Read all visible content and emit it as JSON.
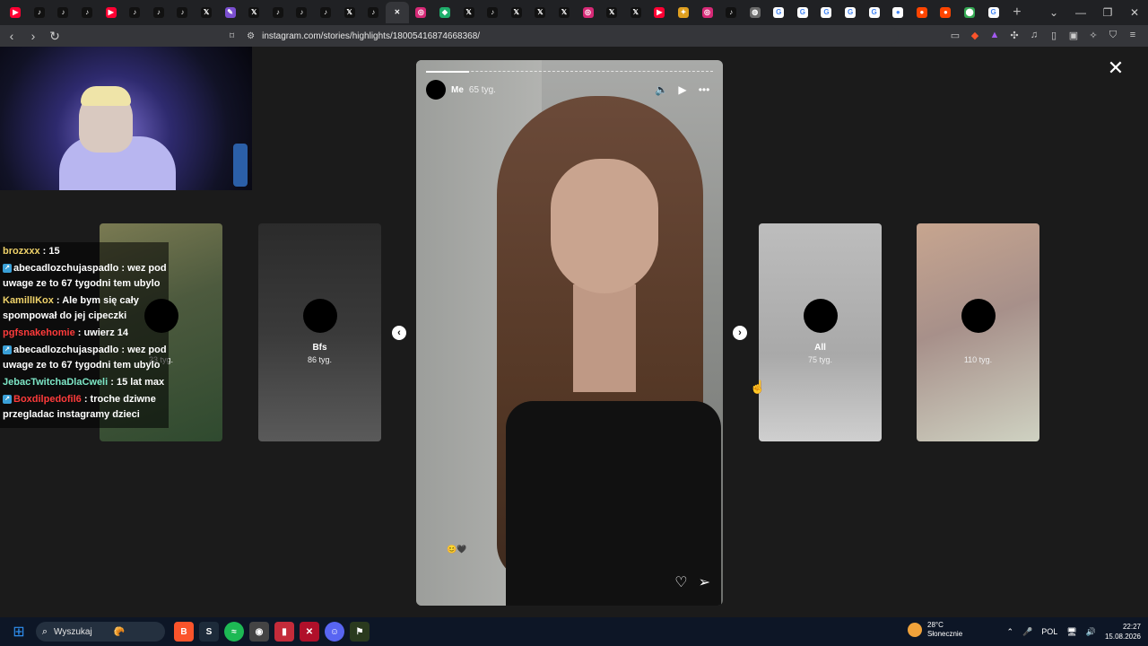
{
  "browser": {
    "tabs": [
      {
        "icon": "youtube-icon",
        "glyph": "▶",
        "color": "#ff0033"
      },
      {
        "icon": "tiktok-icon",
        "glyph": "♪",
        "color": "#111111"
      },
      {
        "icon": "tiktok-icon",
        "glyph": "♪",
        "color": "#111111"
      },
      {
        "icon": "tiktok-icon",
        "glyph": "♪",
        "color": "#111111"
      },
      {
        "icon": "youtube-icon",
        "glyph": "▶",
        "color": "#ff0033"
      },
      {
        "icon": "tiktok-icon",
        "glyph": "♪",
        "color": "#111111"
      },
      {
        "icon": "tiktok-icon",
        "glyph": "♪",
        "color": "#111111"
      },
      {
        "icon": "tiktok-icon",
        "glyph": "♪",
        "color": "#111111"
      },
      {
        "icon": "x-icon",
        "glyph": "𝕏",
        "color": "#111111"
      },
      {
        "icon": "feather-icon",
        "glyph": "✎",
        "color": "#7b4fd0"
      },
      {
        "icon": "x-icon",
        "glyph": "𝕏",
        "color": "#111111"
      },
      {
        "icon": "tiktok-icon",
        "glyph": "♪",
        "color": "#111111"
      },
      {
        "icon": "tiktok-icon",
        "glyph": "♪",
        "color": "#111111"
      },
      {
        "icon": "tiktok-icon",
        "glyph": "♪",
        "color": "#111111"
      },
      {
        "icon": "x-icon",
        "glyph": "𝕏",
        "color": "#111111"
      },
      {
        "icon": "tiktok-icon",
        "glyph": "♪",
        "color": "#111111"
      },
      {
        "icon": "close-icon",
        "glyph": "✕",
        "color": "#35363a",
        "active": true
      },
      {
        "icon": "instagram-icon",
        "glyph": "◎",
        "color": "#d62976"
      },
      {
        "icon": "green-app-icon",
        "glyph": "◆",
        "color": "#1fae6b"
      },
      {
        "icon": "x-icon",
        "glyph": "𝕏",
        "color": "#111111"
      },
      {
        "icon": "tiktok-icon",
        "glyph": "♪",
        "color": "#111111"
      },
      {
        "icon": "x-icon",
        "glyph": "𝕏",
        "color": "#111111"
      },
      {
        "icon": "x-icon",
        "glyph": "𝕏",
        "color": "#111111"
      },
      {
        "icon": "x-icon",
        "glyph": "𝕏",
        "color": "#111111"
      },
      {
        "icon": "instagram-icon",
        "glyph": "◎",
        "color": "#d62976"
      },
      {
        "icon": "x-icon",
        "glyph": "𝕏",
        "color": "#111111"
      },
      {
        "icon": "x-icon",
        "glyph": "𝕏",
        "color": "#111111"
      },
      {
        "icon": "youtube-icon",
        "glyph": "▶",
        "color": "#ff0033"
      },
      {
        "icon": "colorful-app-icon",
        "glyph": "✦",
        "color": "#e0a020"
      },
      {
        "icon": "instagram-icon",
        "glyph": "◎",
        "color": "#d62976"
      },
      {
        "icon": "tiktok-icon",
        "glyph": "♪",
        "color": "#111111"
      },
      {
        "icon": "globe-icon",
        "glyph": "◍",
        "color": "#6b6b6b"
      },
      {
        "icon": "google-icon",
        "glyph": "G",
        "color": "#ffffff"
      },
      {
        "icon": "google-icon",
        "glyph": "G",
        "color": "#ffffff"
      },
      {
        "icon": "google-icon",
        "glyph": "G",
        "color": "#ffffff"
      },
      {
        "icon": "google-icon",
        "glyph": "G",
        "color": "#ffffff"
      },
      {
        "icon": "google-icon",
        "glyph": "G",
        "color": "#ffffff"
      },
      {
        "icon": "white-circle-icon",
        "glyph": "●",
        "color": "#ffffff"
      },
      {
        "icon": "reddit-icon",
        "glyph": "●",
        "color": "#ff4500"
      },
      {
        "icon": "reddit-icon",
        "glyph": "●",
        "color": "#ff4500"
      },
      {
        "icon": "maps-icon",
        "glyph": "⬤",
        "color": "#34a853"
      },
      {
        "icon": "google-icon",
        "glyph": "G",
        "color": "#ffffff"
      }
    ],
    "url": "instagram.com/stories/highlights/18005416874668368/"
  },
  "cards": [
    {
      "title": "",
      "meta": "23 tyg."
    },
    {
      "title": "Bfs",
      "meta": "86 tyg."
    },
    {
      "title": "All",
      "meta": "75 tyg."
    },
    {
      "title": "",
      "meta": "110 tyg."
    }
  ],
  "story": {
    "name": "Me",
    "age": "65 tyg."
  },
  "chat": [
    {
      "user": "brozxxx",
      "color": "#f0d36a",
      "badge": false,
      "text": " : 15"
    },
    {
      "user": "abecadlozchujaspadlo",
      "color": "#ffffff",
      "badge": true,
      "text": " : wez pod uwage ze to 67 tygodni tem ubylo"
    },
    {
      "user": "KamillIKox",
      "color": "#f0d36a",
      "badge": false,
      "text": " : Ale bym się cały spompował do jej cipeczki"
    },
    {
      "user": "pgfsnakehomie",
      "color": "#ff3b3b",
      "badge": false,
      "text": " : uwierz 14"
    },
    {
      "user": "abecadlozchujaspadlo",
      "color": "#ffffff",
      "badge": true,
      "text": " : wez pod uwage ze to 67 tygodni tem ubylo"
    },
    {
      "user": "JebacTwitchaDlaCweli",
      "color": "#7ee8c8",
      "badge": false,
      "text": " : 15 lat max"
    },
    {
      "user": "Boxdilpedofil6",
      "color": "#ff3b3b",
      "badge": true,
      "text": " : troche dziwne przegladac instagramy dzieci"
    }
  ],
  "taskbar": {
    "search_placeholder": "Wyszukaj",
    "weather_temp": "28°C",
    "weather_desc": "Słonecznie",
    "language": "POL",
    "time": "22:27",
    "date": "15.08.2026",
    "notif_count": "1"
  }
}
